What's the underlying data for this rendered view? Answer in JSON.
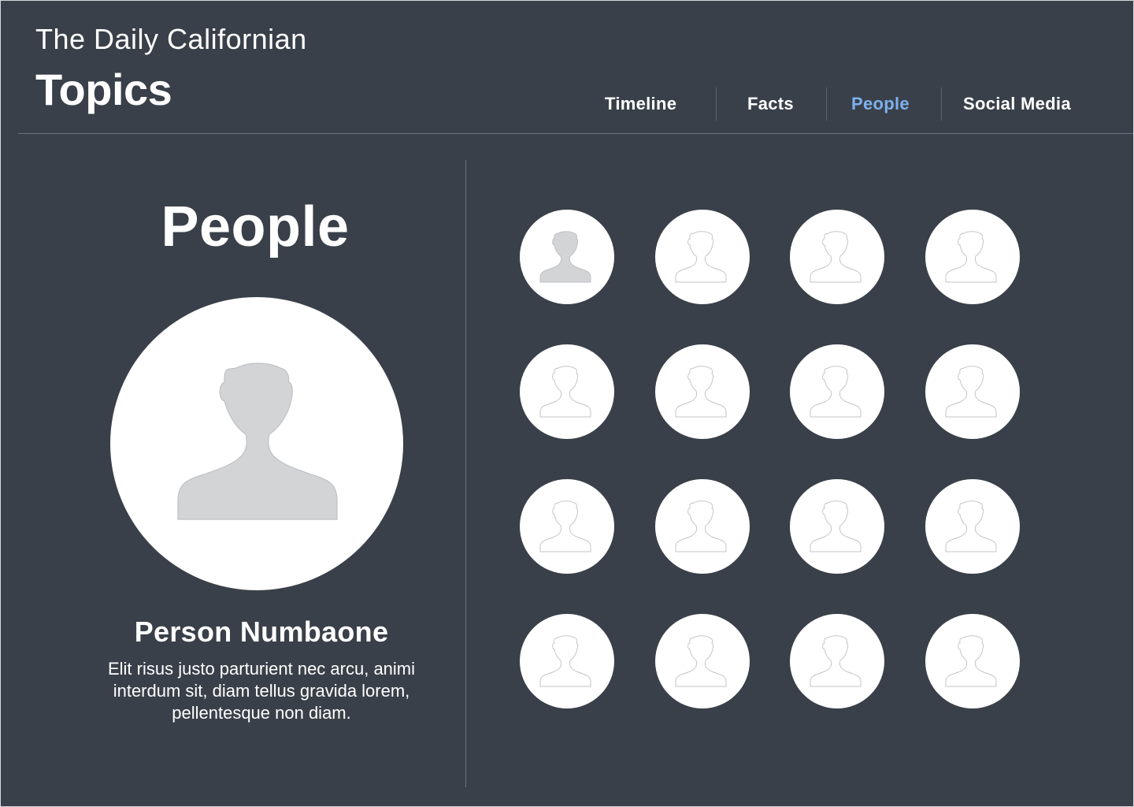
{
  "header": {
    "brand": "The Daily Californian",
    "title": "Topics"
  },
  "nav": {
    "items": [
      {
        "label": "Timeline",
        "active": false
      },
      {
        "label": "Facts",
        "active": false
      },
      {
        "label": "People",
        "active": true
      },
      {
        "label": "Social Media",
        "active": false
      }
    ]
  },
  "colors": {
    "background": "#3a4049",
    "accent": "#7cb1ec",
    "text": "#ffffff",
    "avatar_fill": "#d3d4d6"
  },
  "featured": {
    "section_title": "People",
    "name": "Person Numbaone",
    "bio": "Elit risus justo parturient nec arcu, animi interdum sit, diam tellus gravida lorem, pellentesque non diam.",
    "icon": "person-silhouette-icon"
  },
  "people_grid": {
    "rows": 4,
    "columns": 4,
    "selected_index": 0,
    "icon": "person-outline-icon"
  }
}
